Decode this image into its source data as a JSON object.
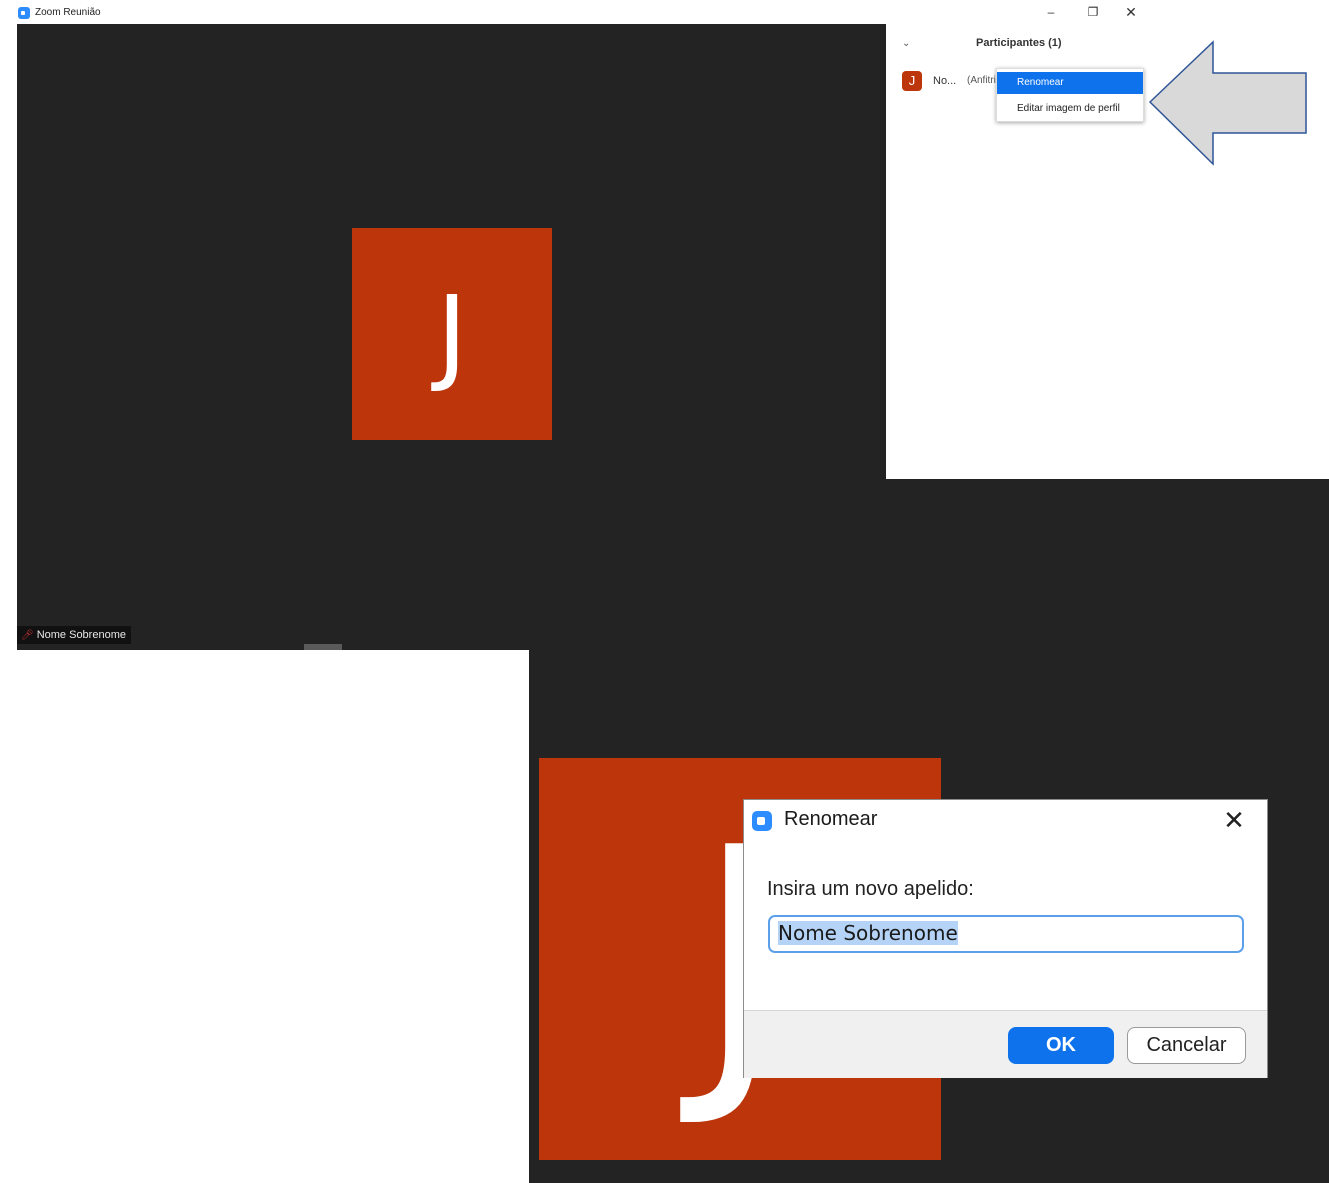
{
  "window": {
    "title": "Zoom Reunião",
    "minimize_glyph": "–",
    "restore_glyph": "❐",
    "close_glyph": "✕"
  },
  "video": {
    "avatar_letter": "J",
    "name_tag": "Nome Sobrenome",
    "avatar_color": "#bd350b",
    "background_color": "#232323"
  },
  "participants_panel": {
    "collapse_glyph": "⌄",
    "title": "Participantes (1)",
    "participant": {
      "avatar_letter": "J",
      "name": "No...",
      "role": "(Anfitrião)"
    },
    "context_menu": [
      {
        "label": "Renomear",
        "selected": true
      },
      {
        "label": "Editar imagem de perfil",
        "selected": false
      }
    ]
  },
  "rename_dialog": {
    "title": "Renomear",
    "close_glyph": "✕",
    "prompt": "Insira um novo apelido:",
    "input_value": "Nome Sobrenome",
    "ok_label": "OK",
    "cancel_label": "Cancelar",
    "background_avatar_letter": "J"
  },
  "colors": {
    "accent": "#0e72ed",
    "zoom_blue": "#2d8cff",
    "arrow_stroke": "#2f5597",
    "arrow_fill": "#d9d9d9"
  }
}
